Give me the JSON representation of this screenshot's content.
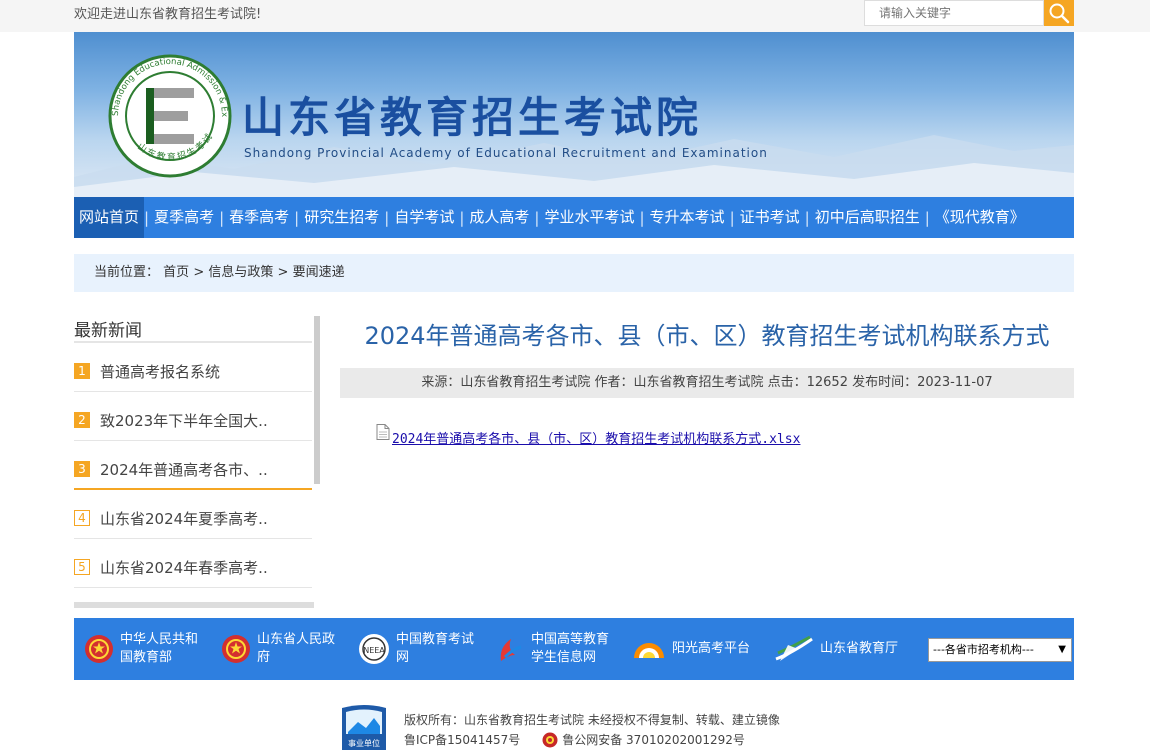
{
  "topbar": {
    "welcome": "欢迎走进山东省教育招生考试院!",
    "search_placeholder": "请输入关键字"
  },
  "banner": {
    "logo_ring_text": "Shandong Educational Admission & Examinations",
    "logo_bottom_text": "山东教育招生考试",
    "title": "山东省教育招生考试院",
    "subtitle": "Shandong Provincial Academy of Educational Recruitment and Examination"
  },
  "nav": [
    {
      "label": "网站首页",
      "active": true
    },
    {
      "label": "夏季高考"
    },
    {
      "label": "春季高考"
    },
    {
      "label": "研究生招考"
    },
    {
      "label": "自学考试"
    },
    {
      "label": "成人高考"
    },
    {
      "label": "学业水平考试"
    },
    {
      "label": "专升本考试"
    },
    {
      "label": "证书考试"
    },
    {
      "label": "初中后高职招生"
    },
    {
      "label": "《现代教育》"
    }
  ],
  "breadcrumb": {
    "prefix": "当前位置：",
    "items": [
      "首页",
      "信息与政策",
      "要闻速递"
    ],
    "sep": ">"
  },
  "sidebar": {
    "heading": "最新新闻",
    "items": [
      {
        "num": "1",
        "text": "普通高考报名系统"
      },
      {
        "num": "2",
        "text": "致2023年下半年全国大.."
      },
      {
        "num": "3",
        "text": "2024年普通高考各市、.."
      },
      {
        "num": "4",
        "text": "山东省2024年夏季高考.."
      },
      {
        "num": "5",
        "text": "山东省2024年春季高考.."
      }
    ]
  },
  "article": {
    "title": "2024年普通高考各市、县（市、区）教育招生考试机构联系方式",
    "meta": "来源：山东省教育招生考试院 作者：山东省教育招生考试院 点击：12652 发布时间：2023-11-07",
    "attachment": "2024年普通高考各市、县（市、区）教育招生考试机构联系方式.xlsx"
  },
  "links": {
    "items": [
      {
        "label": "中华人民共和国教育部",
        "icon": "national-emblem-icon"
      },
      {
        "label": "山东省人民政府",
        "icon": "national-emblem-icon"
      },
      {
        "label": "中国教育考试网",
        "icon": "neea-logo-icon"
      },
      {
        "label": "中国高等教育学生信息网",
        "icon": "chsi-logo-icon"
      },
      {
        "label": "阳光高考平台",
        "icon": "sun-logo-icon"
      },
      {
        "label": "山东省教育厅",
        "icon": "edu-dept-logo-icon"
      }
    ],
    "select_value": "---各省市招考机构---"
  },
  "footer": {
    "copyright": "版权所有：山东省教育招生考试院 未经授权不得复制、转载、建立镜像",
    "icp": "鲁ICP备15041457号",
    "police": "鲁公网安备 37010202001292号",
    "badge_text": "事业单位"
  },
  "colors": {
    "nav_blue": "#2e7fe0",
    "accent_orange": "#f5a623",
    "title_blue": "#2a63a8"
  }
}
